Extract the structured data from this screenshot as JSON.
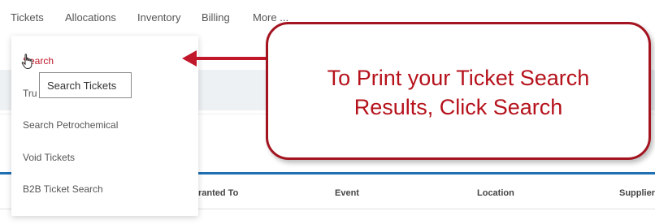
{
  "nav": {
    "items": [
      "Tickets",
      "Allocations",
      "Inventory",
      "Billing",
      "More ..."
    ]
  },
  "menu": {
    "items": [
      {
        "label": "Search",
        "active": true
      },
      {
        "label": "Tru"
      },
      {
        "label": "Search Petrochemical"
      },
      {
        "label": "Void Tickets"
      },
      {
        "label": "B2B Ticket Search"
      }
    ]
  },
  "tooltip": {
    "text": "Search Tickets"
  },
  "table": {
    "columns": [
      "ranted To",
      "Event",
      "Location",
      "Supplier"
    ]
  },
  "callout": {
    "line1": "To Print your Ticket Search",
    "line2": "Results, Click Search"
  },
  "colors": {
    "accent_red": "#c0182a",
    "callout_border": "#a31420",
    "table_header_line": "#1f6fb2"
  },
  "icons": {
    "cursor": "hand-pointer-icon",
    "arrow": "left-arrow-icon"
  }
}
